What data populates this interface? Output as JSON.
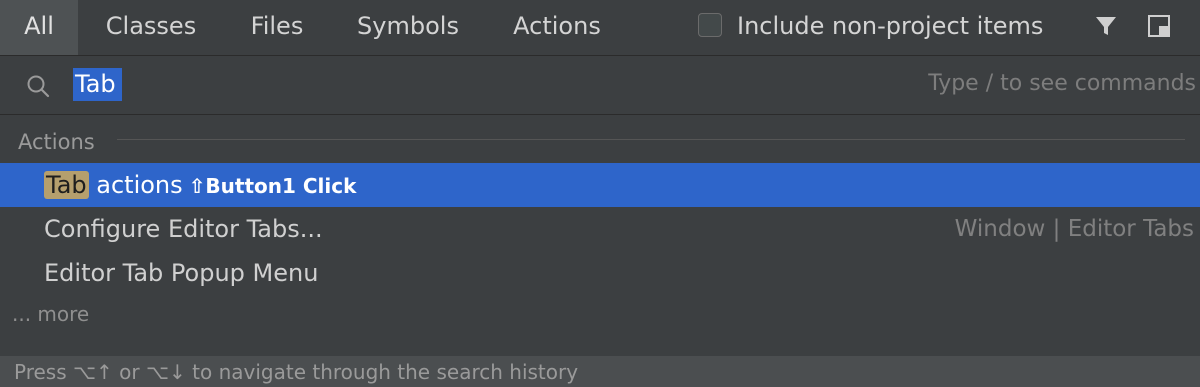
{
  "tabs": [
    {
      "label": "All",
      "selected": true
    },
    {
      "label": "Classes",
      "selected": false
    },
    {
      "label": "Files",
      "selected": false
    },
    {
      "label": "Symbols",
      "selected": false
    },
    {
      "label": "Actions",
      "selected": false
    }
  ],
  "include_non_project": {
    "label": "Include non-project items",
    "checked": false
  },
  "toolbar": {
    "filter_icon": "filter-icon",
    "window_icon": "window-icon"
  },
  "search": {
    "query": "Tab",
    "hint": "Type / to see commands",
    "icon": "search-icon"
  },
  "results": {
    "group": "Actions",
    "items": [
      {
        "match": "Tab",
        "rest": " actions",
        "shortcut": "⇧Button1 Click",
        "hint": "",
        "selected": true
      },
      {
        "title": "Configure Editor Tabs...",
        "hint": "Window | Editor Tabs",
        "selected": false
      },
      {
        "title": "Editor Tab Popup Menu",
        "hint": "",
        "selected": false
      }
    ],
    "more": "... more"
  },
  "footer": {
    "text": "Press ⌥↑ or ⌥↓ to navigate through the search history"
  },
  "colors": {
    "accent": "#2e65ca",
    "match_highlight": "#b59f6d",
    "background": "#3c3f41"
  }
}
